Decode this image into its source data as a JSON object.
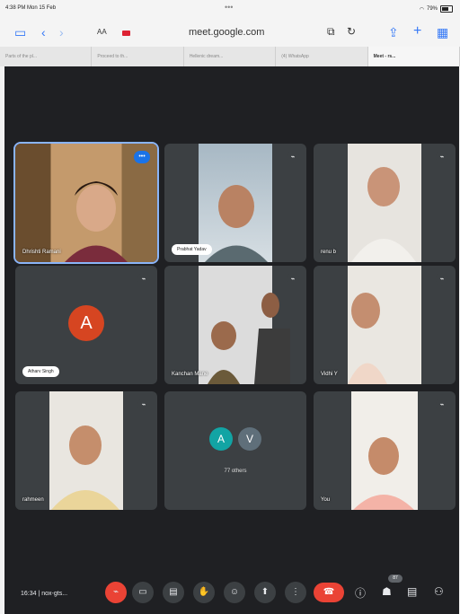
{
  "status": {
    "time": "4:38 PM Mon 15 Feb",
    "battery": "79%"
  },
  "browser": {
    "url": "meet.google.com",
    "reader": "AA",
    "tabs": [
      {
        "title": "Parts of the pl..."
      },
      {
        "title": "Proceed to th..."
      },
      {
        "title": "Hellenic dream..."
      },
      {
        "title": "(4) WhatsApp"
      },
      {
        "title": "Meet - rs..."
      }
    ]
  },
  "participants": [
    {
      "name": "Dhrishti Ramani",
      "speaking": true
    },
    {
      "name": "Prabhat Yadav",
      "chip": true
    },
    {
      "name": "renu b"
    },
    {
      "name": "Atharv Singh",
      "chip": true,
      "avatar": "A"
    },
    {
      "name": "Kanchan Mane"
    },
    {
      "name": "Vidhi Y"
    },
    {
      "name": "rahmeen"
    },
    {
      "avatars": [
        "A",
        "V"
      ],
      "label": "77 others"
    },
    {
      "name": "You"
    }
  ],
  "controls": {
    "clock": "16:34",
    "meeting_code": "nox-gts..."
  },
  "people_count": "87"
}
